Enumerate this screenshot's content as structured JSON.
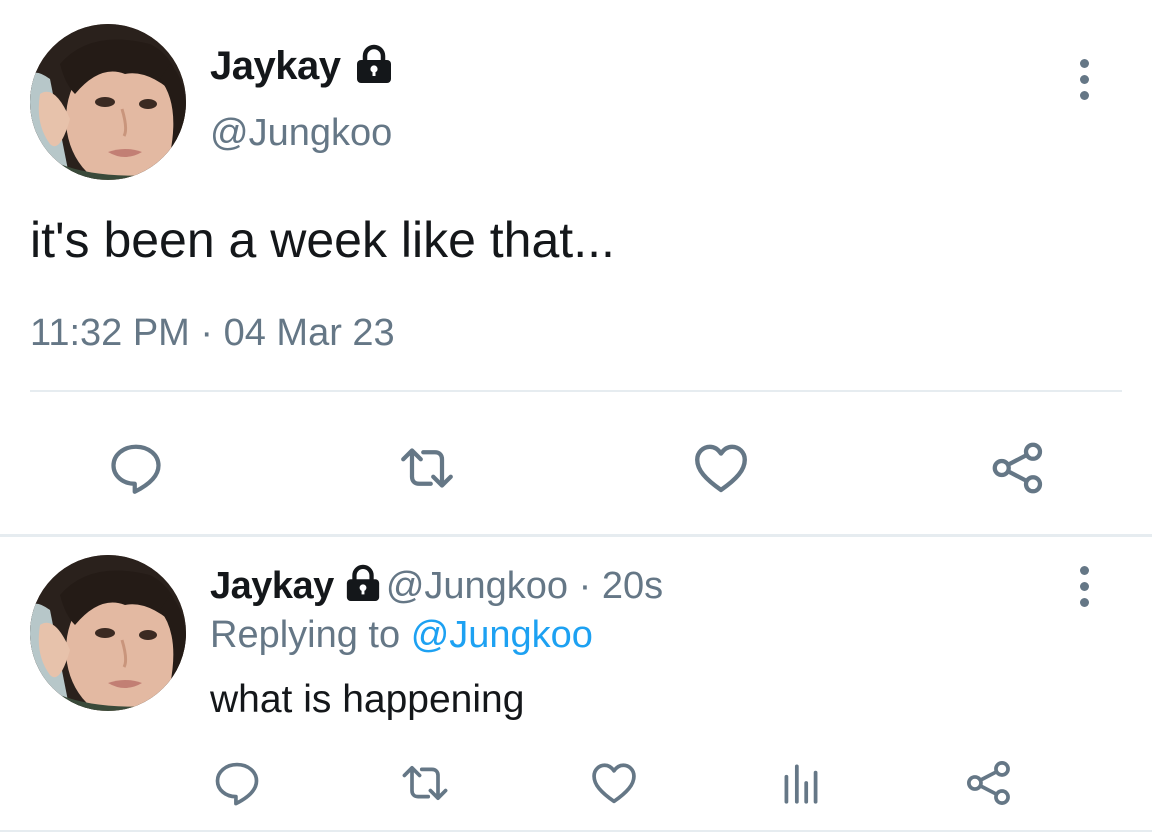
{
  "main_tweet": {
    "display_name": "Jaykay",
    "handle": "@Jungkoo",
    "text": "it's been a week like that...",
    "timestamp": "11:32 PM · 04 Mar 23",
    "avatar": "profile-photo",
    "actions": [
      "reply-icon",
      "retweet-icon",
      "like-icon",
      "share-icon"
    ]
  },
  "reply_tweet": {
    "display_name": "Jaykay",
    "handle": "@Jungkoo",
    "separator": "·",
    "relative_time": "20s",
    "replying_label": "Replying to",
    "replying_to": "@Jungkoo",
    "text": "what is happening",
    "avatar": "profile-photo",
    "actions": [
      "reply-icon",
      "retweet-icon",
      "like-icon",
      "analytics-icon",
      "share-icon"
    ]
  },
  "colors": {
    "text_primary": "#14171a",
    "text_secondary": "#657786",
    "icon": "#657786",
    "link": "#1da1f2",
    "divider": "#e6ecf0",
    "background": "#ffffff"
  }
}
